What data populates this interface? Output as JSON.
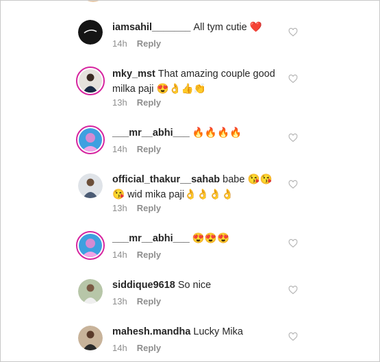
{
  "comments": [
    {
      "username": "iamsahil_______",
      "text": "All tym cutie ❤️",
      "time": "14h",
      "reply": "Reply"
    },
    {
      "username": "mky_mst",
      "text": "That amazing couple good milka paji 😍👌👍👏",
      "time": "13h",
      "reply": "Reply"
    },
    {
      "username": "___mr__abhi___",
      "text": "🔥🔥🔥🔥",
      "time": "14h",
      "reply": "Reply"
    },
    {
      "username": "official_thakur__sahab",
      "text": "babe 😘😘😘 wid mika paji👌👌👌👌",
      "time": "13h",
      "reply": "Reply"
    },
    {
      "username": "___mr__abhi___",
      "text": "😍😍😍",
      "time": "14h",
      "reply": "Reply"
    },
    {
      "username": "siddique9618",
      "text": "So nice",
      "time": "13h",
      "reply": "Reply"
    },
    {
      "username": "mahesh.mandha",
      "text": "Lucky Mika",
      "time": "14h",
      "reply": "Reply"
    }
  ]
}
